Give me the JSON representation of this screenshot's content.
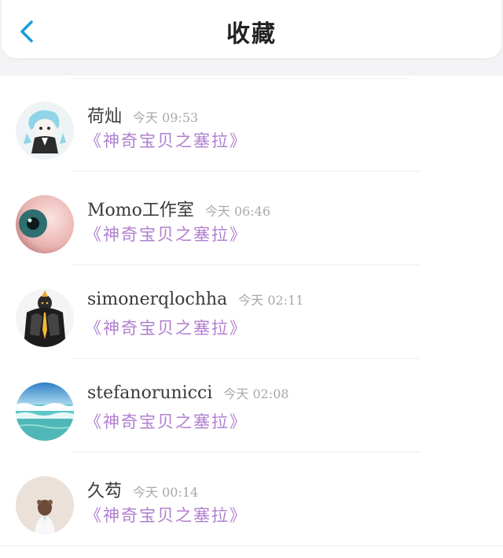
{
  "header": {
    "title": "收藏"
  },
  "colors": {
    "accent": "#1e9bd7",
    "link": "#b07fd0",
    "time": "#a8a8a8"
  },
  "favorites": [
    {
      "name": "荷灿",
      "time": "今天 09:53",
      "link": "《神奇宝贝之塞拉》",
      "avatar": "anime-character-avatar"
    },
    {
      "name": "Momo工作室",
      "time": "今天 06:46",
      "link": "《神奇宝贝之塞拉》",
      "avatar": "eyeball-avatar"
    },
    {
      "name": "simonerqlochha",
      "time": "今天 02:11",
      "link": "《神奇宝贝之塞拉》",
      "avatar": "armored-warrior-avatar"
    },
    {
      "name": "stefanorunicci",
      "time": "今天 02:08",
      "link": "《神奇宝贝之塞拉》",
      "avatar": "ocean-waves-avatar"
    },
    {
      "name": "久芶",
      "time": "今天 00:14",
      "link": "《神奇宝贝之塞拉》",
      "avatar": "girl-back-avatar"
    }
  ]
}
